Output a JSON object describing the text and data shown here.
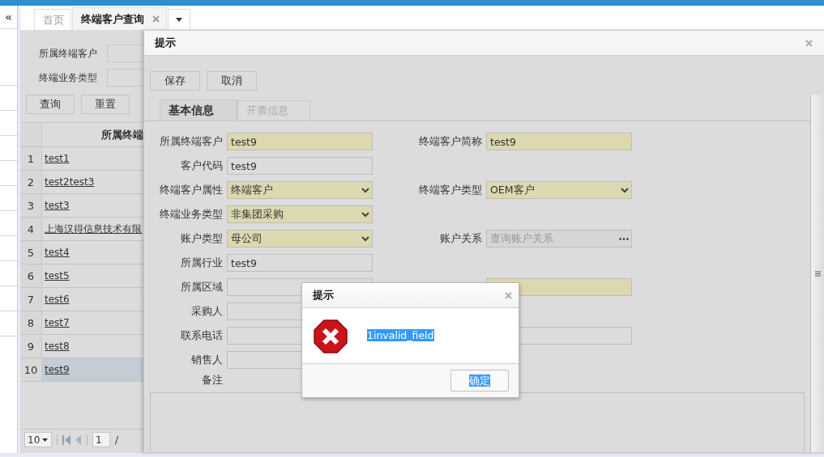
{
  "sidebar": {
    "collapse_icon": "«"
  },
  "tabs": [
    {
      "label": "首页",
      "selected": false,
      "closable": false
    },
    {
      "label": "终端客户查询",
      "selected": true,
      "closable": true
    }
  ],
  "search_form": {
    "fields": [
      {
        "label": "所属终端客户"
      },
      {
        "label": "终端业务类型"
      }
    ],
    "buttons": [
      "查询",
      "重置"
    ]
  },
  "grid": {
    "columns": [
      "所属终端"
    ],
    "rows": [
      {
        "index": "1",
        "name": "test1",
        "selected": false
      },
      {
        "index": "2",
        "name": "test2test3",
        "selected": false
      },
      {
        "index": "3",
        "name": "test3",
        "selected": false
      },
      {
        "index": "4",
        "name": "上海汉得信息技术有限",
        "selected": false
      },
      {
        "index": "5",
        "name": "test4",
        "selected": false
      },
      {
        "index": "6",
        "name": "test5",
        "selected": false
      },
      {
        "index": "7",
        "name": "test6",
        "selected": false
      },
      {
        "index": "8",
        "name": "test7",
        "selected": false
      },
      {
        "index": "9",
        "name": "test8",
        "selected": false
      },
      {
        "index": "10",
        "name": "test9",
        "selected": true
      }
    ]
  },
  "pager": {
    "page_size": "10",
    "page": "1",
    "separator": "/"
  },
  "dialog": {
    "title": "提示",
    "buttons": [
      "保存",
      "取消"
    ],
    "tabs": [
      {
        "label": "基本信息",
        "selected": true
      },
      {
        "label": "开票信息",
        "selected": false
      }
    ],
    "rows": [
      {
        "left": {
          "label": "所属终端客户",
          "value": "test9",
          "kind": "text",
          "required": true
        },
        "right": {
          "label": "终端客户简称",
          "value": "test9",
          "kind": "text",
          "required": true
        }
      },
      {
        "left": {
          "label": "客户代码",
          "value": "test9",
          "kind": "text",
          "required": false
        }
      },
      {
        "left": {
          "label": "终端客户属性",
          "value": "终端客户",
          "kind": "select",
          "required": true
        },
        "right": {
          "label": "终端客户类型",
          "value": "OEM客户",
          "kind": "select",
          "required": true
        }
      },
      {
        "left": {
          "label": "终端业务类型",
          "value": "非集团采购",
          "kind": "select",
          "required": true
        }
      },
      {
        "left": {
          "label": "账户类型",
          "value": "母公司",
          "kind": "select",
          "required": true
        },
        "right": {
          "label": "账户关系",
          "placeholder": "查询账户关系",
          "kind": "lookup",
          "required": false
        }
      },
      {
        "left": {
          "label": "所属行业",
          "value": "test9",
          "kind": "text",
          "required": false
        }
      },
      {
        "left": {
          "label": "所属区域",
          "kind": "text",
          "required": false
        },
        "right": {
          "kind": "text",
          "required": true
        }
      },
      {
        "left": {
          "label": "采购人",
          "kind": "text",
          "required": false
        }
      },
      {
        "left": {
          "label": "联系电话",
          "kind": "text",
          "required": false
        },
        "right": {
          "kind": "text",
          "required": false
        }
      },
      {
        "left": {
          "label": "销售人",
          "kind": "text",
          "required": false
        }
      }
    ],
    "remark": {
      "label": "备注"
    }
  },
  "alert": {
    "title": "提示",
    "message": "1invalid_field",
    "button": "确定",
    "text_selected": true
  }
}
